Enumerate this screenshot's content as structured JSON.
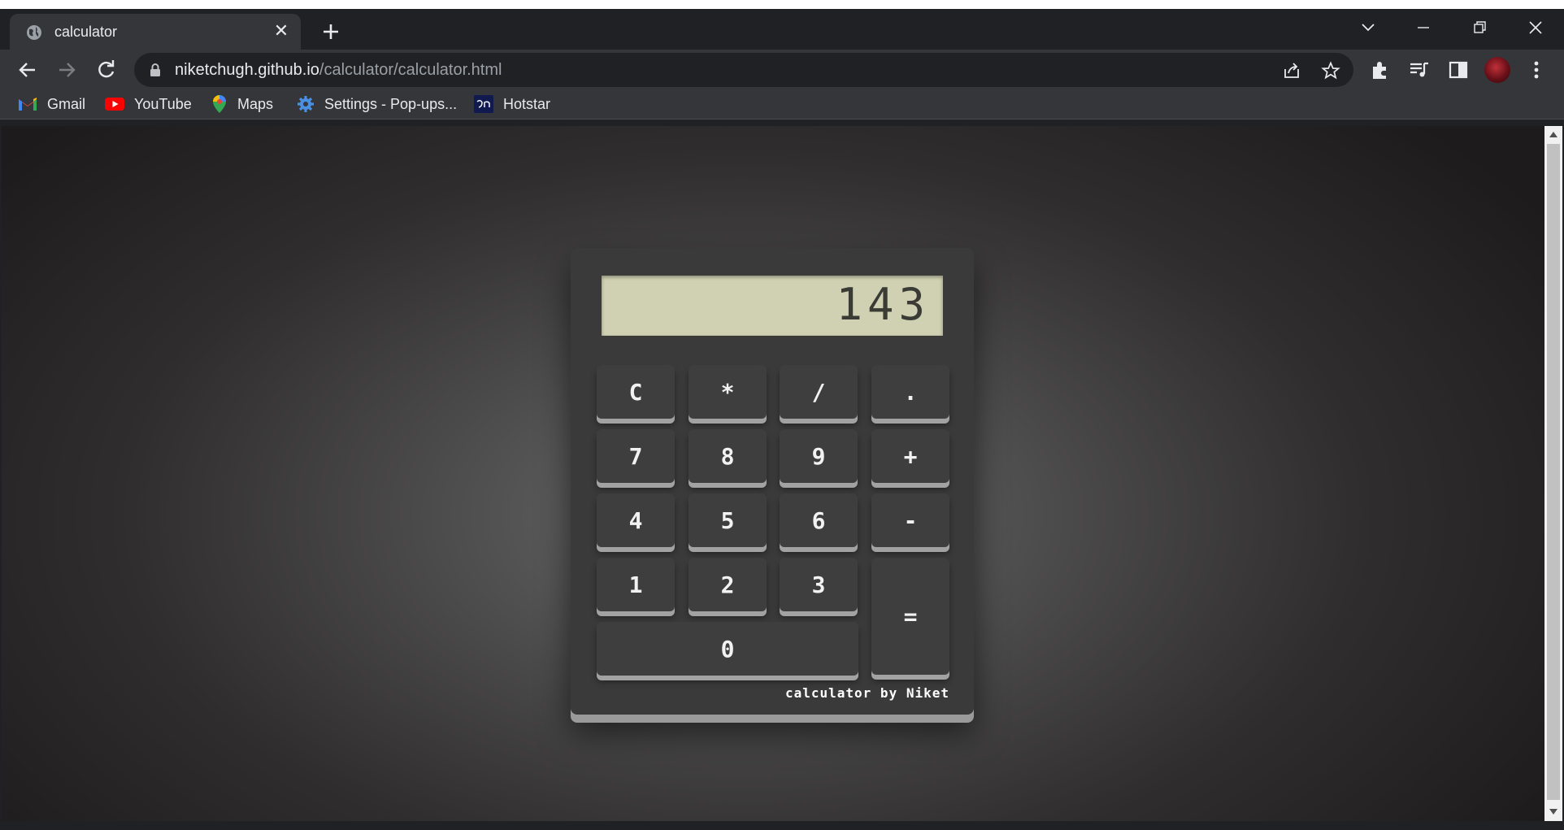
{
  "browser": {
    "tab": {
      "title": "calculator",
      "close_glyph": "✕",
      "favicon": "globe-icon"
    },
    "address": {
      "host": "niketchugh.github.io",
      "path": "/calculator/calculator.html"
    },
    "bookmarks": [
      {
        "label": "Gmail",
        "icon": "gmail-icon"
      },
      {
        "label": "YouTube",
        "icon": "youtube-icon"
      },
      {
        "label": "Maps",
        "icon": "maps-icon"
      },
      {
        "label": "Settings - Pop-ups...",
        "icon": "settings-gear-icon"
      },
      {
        "label": "Hotstar",
        "icon": "hotstar-icon"
      }
    ]
  },
  "calculator": {
    "display": "143",
    "keys": {
      "clear": "C",
      "multiply": "*",
      "divide": "/",
      "decimal": ".",
      "seven": "7",
      "eight": "8",
      "nine": "9",
      "plus": "+",
      "four": "4",
      "five": "5",
      "six": "6",
      "minus": "-",
      "one": "1",
      "two": "2",
      "three": "3",
      "equals": "=",
      "zero": "0"
    },
    "credit": "calculator by Niket"
  },
  "colors": {
    "browser_frame": "#202124",
    "toolbar": "#35363a",
    "calculator_body": "#3a3a3a",
    "display_bg": "#cfd1b2",
    "key_shadow": "#a2a2a2"
  }
}
